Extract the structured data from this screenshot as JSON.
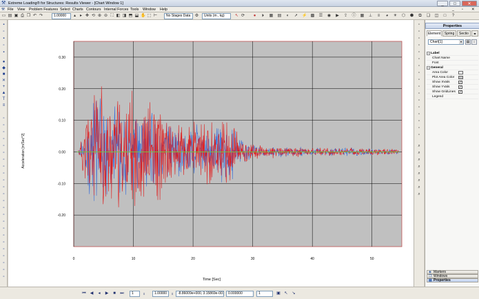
{
  "window": {
    "title": "Extreme Loading® for Structures: Results Viewer - [Chart Window 1]",
    "controls": [
      "_",
      "□",
      "✕"
    ]
  },
  "menu": [
    "File",
    "View",
    "Problem Features",
    "Select",
    "Charts",
    "Contours",
    "Internal Forces",
    "Tools",
    "Window",
    "Help"
  ],
  "toolbar": {
    "scale_value": "1.00000",
    "stage_dropdown": "No Stages Data",
    "units_dropdown": "Units (m , kg)"
  },
  "properties": {
    "header": "Properties",
    "tabs": [
      "Element",
      "Spring",
      "Sectio"
    ],
    "selected_object": "Chart[1]",
    "categories": [
      {
        "name": "Label",
        "rows": [
          {
            "label": "Chart Name"
          },
          {
            "label": "Font"
          }
        ]
      },
      {
        "name": "General",
        "rows": [
          {
            "label": "Area Color",
            "swatch": "#ffffff"
          },
          {
            "label": "Plot Area Color",
            "swatch": "#c0c0c0"
          },
          {
            "label": "Show XVals",
            "check": "✓"
          },
          {
            "label": "Show YVals",
            "check": "✓"
          },
          {
            "label": "Show GridLines",
            "check": "✓"
          },
          {
            "label": "Legend"
          }
        ]
      }
    ],
    "bottom_buttons": [
      "Markers",
      "Windows",
      "Properties"
    ]
  },
  "playback": {
    "step_value": "1",
    "scale_value": "1.00000",
    "coordinates": "-8.86009e+000, 3.15869e-001",
    "time_value": "0.000000",
    "frame_value": "1"
  },
  "colors": {
    "series_red": "#e01b1b",
    "series_blue": "#3a6fd8",
    "plot_area": "#c0c0c0",
    "plot_border": "#c05050",
    "zero_line": "#6fcf3f"
  },
  "chart_data": {
    "type": "line",
    "xlabel": "Time [Sec]",
    "ylabel": "Acceleration [m/Sec^2]",
    "xlim": [
      0,
      55
    ],
    "ylim": [
      -0.3,
      0.35
    ],
    "xticks": [
      "0",
      "10",
      "20",
      "30",
      "40",
      "50"
    ],
    "yticks": [
      "0.30",
      "0.20",
      "0.10",
      "0.00",
      "-0.10",
      "-0.20"
    ],
    "ytick_values": [
      0.3,
      0.2,
      0.1,
      0.0,
      -0.1,
      -0.2
    ],
    "xtick_values": [
      0,
      10,
      20,
      30,
      40,
      50
    ],
    "grid": true,
    "series": [
      {
        "color": "#e01b1b",
        "envelope": [
          {
            "t": 1,
            "a": 0.02
          },
          {
            "t": 2,
            "a": 0.16
          },
          {
            "t": 3,
            "a": 0.29
          },
          {
            "t": 4,
            "a": 0.26
          },
          {
            "t": 5,
            "a": 0.22
          },
          {
            "t": 7,
            "a": 0.2
          },
          {
            "t": 10,
            "a": 0.2
          },
          {
            "t": 12,
            "a": 0.2
          },
          {
            "t": 14,
            "a": 0.18
          },
          {
            "t": 17,
            "a": 0.12
          },
          {
            "t": 20,
            "a": 0.11
          },
          {
            "t": 23,
            "a": 0.12
          },
          {
            "t": 26,
            "a": 0.11
          },
          {
            "t": 28,
            "a": 0.06
          },
          {
            "t": 30,
            "a": 0.03
          },
          {
            "t": 35,
            "a": 0.02
          },
          {
            "t": 40,
            "a": 0.015
          },
          {
            "t": 45,
            "a": 0.015
          },
          {
            "t": 50,
            "a": 0.012
          },
          {
            "t": 54,
            "a": 0.01
          }
        ]
      },
      {
        "color": "#3a6fd8",
        "envelope": [
          {
            "t": 1,
            "a": 0.015
          },
          {
            "t": 2,
            "a": 0.1
          },
          {
            "t": 3,
            "a": 0.2
          },
          {
            "t": 5,
            "a": 0.18
          },
          {
            "t": 7,
            "a": 0.15
          },
          {
            "t": 10,
            "a": 0.14
          },
          {
            "t": 12,
            "a": 0.16
          },
          {
            "t": 14,
            "a": 0.12
          },
          {
            "t": 17,
            "a": 0.1
          },
          {
            "t": 20,
            "a": 0.09
          },
          {
            "t": 23,
            "a": 0.1
          },
          {
            "t": 26,
            "a": 0.11
          },
          {
            "t": 28,
            "a": 0.05
          },
          {
            "t": 30,
            "a": 0.025
          },
          {
            "t": 35,
            "a": 0.02
          },
          {
            "t": 40,
            "a": 0.015
          },
          {
            "t": 45,
            "a": 0.014
          },
          {
            "t": 50,
            "a": 0.012
          },
          {
            "t": 54,
            "a": 0.01
          }
        ]
      }
    ]
  }
}
